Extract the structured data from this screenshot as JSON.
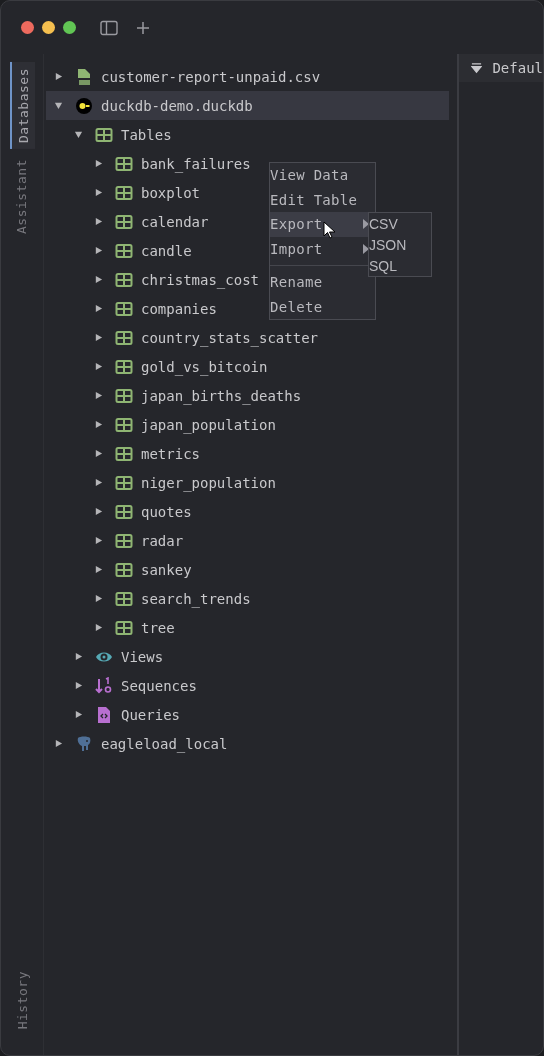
{
  "side_tabs": [
    {
      "label": "Databases",
      "selected": true
    },
    {
      "label": "Assistant",
      "selected": false
    }
  ],
  "bottom_tab": {
    "label": "History",
    "selected": false
  },
  "tree": [
    {
      "kind": "csv",
      "label": "customer-report-unpaid.csv",
      "expanded": false,
      "selected": false
    },
    {
      "kind": "duckdb",
      "label": "duckdb-demo.duckdb",
      "expanded": true,
      "selected": true,
      "children": [
        {
          "kind": "tables",
          "label": "Tables",
          "expanded": true,
          "selected": false,
          "children": [
            {
              "kind": "table",
              "label": "bank_failures",
              "expanded": false,
              "selected": false
            },
            {
              "kind": "table",
              "label": "boxplot",
              "expanded": false,
              "selected": false
            },
            {
              "kind": "table",
              "label": "calendar",
              "expanded": false,
              "selected": false
            },
            {
              "kind": "table",
              "label": "candle",
              "expanded": false,
              "selected": false
            },
            {
              "kind": "table",
              "label": "christmas_cost",
              "expanded": false,
              "selected": false
            },
            {
              "kind": "table",
              "label": "companies",
              "expanded": false,
              "selected": false
            },
            {
              "kind": "table",
              "label": "country_stats_scatter",
              "expanded": false,
              "selected": false
            },
            {
              "kind": "table",
              "label": "gold_vs_bitcoin",
              "expanded": false,
              "selected": false
            },
            {
              "kind": "table",
              "label": "japan_births_deaths",
              "expanded": false,
              "selected": false
            },
            {
              "kind": "table",
              "label": "japan_population",
              "expanded": false,
              "selected": false
            },
            {
              "kind": "table",
              "label": "metrics",
              "expanded": false,
              "selected": false
            },
            {
              "kind": "table",
              "label": "niger_population",
              "expanded": false,
              "selected": false
            },
            {
              "kind": "table",
              "label": "quotes",
              "expanded": false,
              "selected": false
            },
            {
              "kind": "table",
              "label": "radar",
              "expanded": false,
              "selected": false
            },
            {
              "kind": "table",
              "label": "sankey",
              "expanded": false,
              "selected": false
            },
            {
              "kind": "table",
              "label": "search_trends",
              "expanded": false,
              "selected": false
            },
            {
              "kind": "table",
              "label": "tree",
              "expanded": false,
              "selected": false
            }
          ]
        },
        {
          "kind": "views",
          "label": "Views",
          "expanded": false,
          "selected": false
        },
        {
          "kind": "sequences",
          "label": "Sequences",
          "expanded": false,
          "selected": false
        },
        {
          "kind": "queries",
          "label": "Queries",
          "expanded": false,
          "selected": false
        }
      ]
    },
    {
      "kind": "postgres",
      "label": "eagleload_local",
      "expanded": false,
      "selected": false
    }
  ],
  "context_menu": {
    "items": [
      {
        "kind": "item",
        "label": "View Data",
        "selected": false,
        "submenu": false
      },
      {
        "kind": "item",
        "label": "Edit Table",
        "selected": false,
        "submenu": false
      },
      {
        "kind": "item",
        "label": "Export",
        "selected": true,
        "submenu": true
      },
      {
        "kind": "item",
        "label": "Import",
        "selected": false,
        "submenu": true
      },
      {
        "kind": "separator"
      },
      {
        "kind": "item",
        "label": "Rename",
        "selected": false,
        "submenu": false
      },
      {
        "kind": "item",
        "label": "Delete",
        "selected": false,
        "submenu": false
      }
    ],
    "submenu": [
      "CSV",
      "JSON",
      "SQL"
    ]
  },
  "right_panel": {
    "header": "Defaul"
  }
}
